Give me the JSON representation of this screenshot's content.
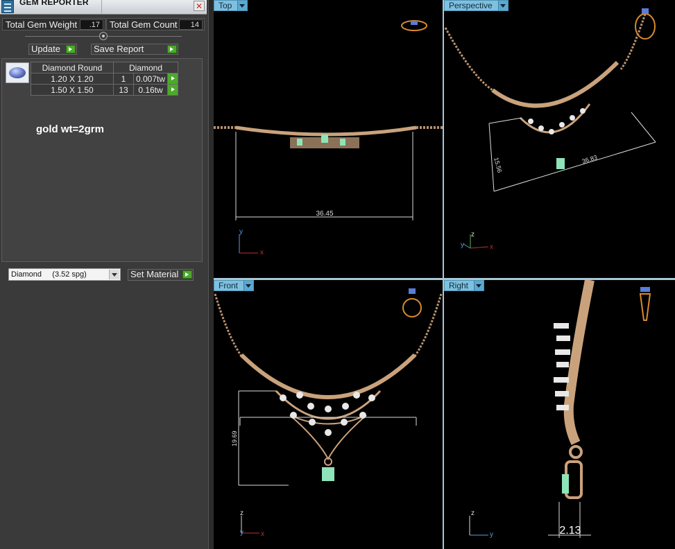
{
  "window": {
    "title": "GEM REPORTER",
    "close_label": "✕"
  },
  "stats": {
    "total_weight_label": "Total Gem Weight",
    "total_weight_value": ".17",
    "total_count_label": "Total Gem Count",
    "total_count_value": "14"
  },
  "buttons": {
    "update": "Update",
    "save_report": "Save Report",
    "set_material": "Set Material"
  },
  "gem_table": {
    "headers": [
      "Diamond Round",
      "Diamond"
    ],
    "rows": [
      {
        "size": "1.20 X 1.20",
        "count": "1",
        "weight": "0.007tw"
      },
      {
        "size": "1.50 X 1.50",
        "count": "13",
        "weight": "0.16tw"
      }
    ]
  },
  "note": "gold wt=2grm",
  "material_select": {
    "value": "Diamond     (3.52 spg)"
  },
  "viewports": [
    {
      "label": "Top",
      "dimension": "36.45",
      "axes": [
        "y",
        "x"
      ]
    },
    {
      "label": "Perspective",
      "dimension_a": "15.56",
      "dimension_b": "36.83",
      "axes": [
        "z",
        "y",
        "x"
      ]
    },
    {
      "label": "Front",
      "dimension": "19.69",
      "axes": [
        "z",
        "y",
        "x"
      ]
    },
    {
      "label": "Right",
      "dimension": "2.13",
      "axes": [
        "z",
        "y"
      ]
    }
  ],
  "colors": {
    "viewport_bg": "#000000",
    "tab_bg": "#7fc0df",
    "gold": "#c9a27c",
    "gem_green": "#8fe3b8",
    "panel_bg": "#3a3a3a"
  }
}
